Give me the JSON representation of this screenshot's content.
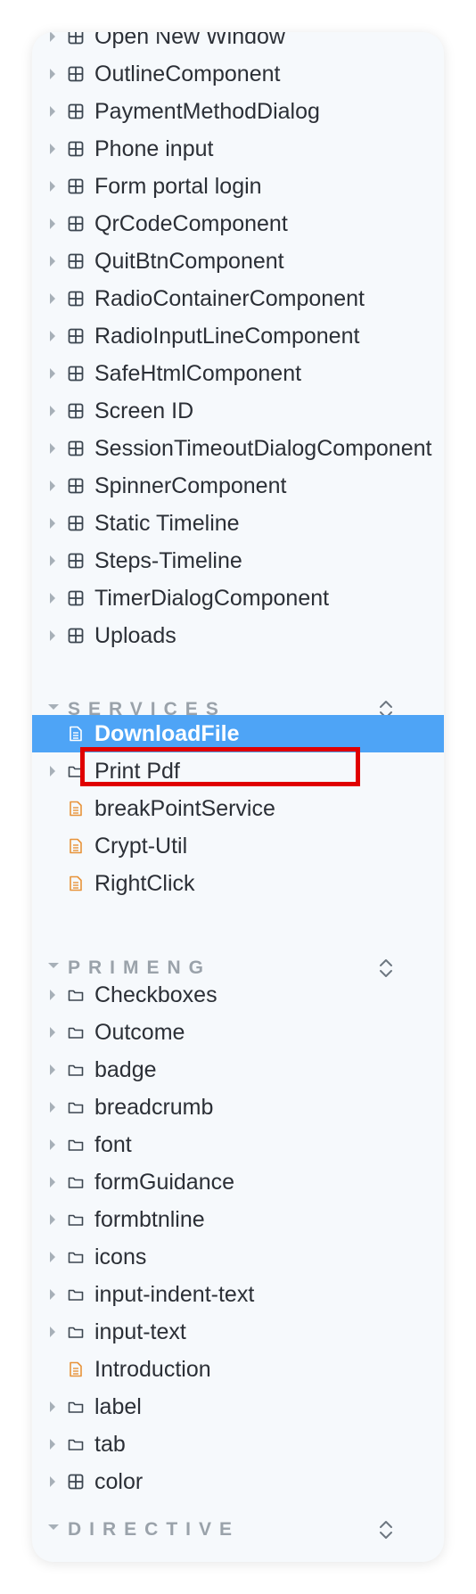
{
  "components": [
    {
      "label": "Open New Window",
      "icon": "component-icon",
      "expandable": true
    },
    {
      "label": "OutlineComponent",
      "icon": "component-icon",
      "expandable": true
    },
    {
      "label": "PaymentMethodDialog",
      "icon": "component-icon",
      "expandable": true
    },
    {
      "label": "Phone input",
      "icon": "component-icon",
      "expandable": true
    },
    {
      "label": "Form portal login",
      "icon": "component-icon",
      "expandable": true
    },
    {
      "label": "QrCodeComponent",
      "icon": "component-icon",
      "expandable": true
    },
    {
      "label": "QuitBtnComponent",
      "icon": "component-icon",
      "expandable": true
    },
    {
      "label": "RadioContainerComponent",
      "icon": "component-icon",
      "expandable": true
    },
    {
      "label": "RadioInputLineComponent",
      "icon": "component-icon",
      "expandable": true
    },
    {
      "label": "SafeHtmlComponent",
      "icon": "component-icon",
      "expandable": true
    },
    {
      "label": "Screen ID",
      "icon": "component-icon",
      "expandable": true
    },
    {
      "label": "SessionTimeoutDialogComponent",
      "icon": "component-icon",
      "expandable": true
    },
    {
      "label": "SpinnerComponent",
      "icon": "component-icon",
      "expandable": true
    },
    {
      "label": "Static Timeline",
      "icon": "component-icon",
      "expandable": true
    },
    {
      "label": "Steps-Timeline",
      "icon": "component-icon",
      "expandable": true
    },
    {
      "label": "TimerDialogComponent",
      "icon": "component-icon",
      "expandable": true
    },
    {
      "label": "Uploads",
      "icon": "component-icon",
      "expandable": true
    }
  ],
  "services": {
    "title": "SERVICES",
    "items": [
      {
        "label": "DownloadFile",
        "icon": "document-icon",
        "expandable": false,
        "selected": true
      },
      {
        "label": "Print Pdf",
        "icon": "folder-icon",
        "expandable": true
      },
      {
        "label": "breakPointService",
        "icon": "document-icon",
        "expandable": false
      },
      {
        "label": "Crypt-Util",
        "icon": "document-icon",
        "expandable": false
      },
      {
        "label": "RightClick",
        "icon": "document-icon",
        "expandable": false
      }
    ]
  },
  "primeng": {
    "title": "PRIMENG",
    "items": [
      {
        "label": "Checkboxes",
        "icon": "folder-icon",
        "expandable": true
      },
      {
        "label": "Outcome",
        "icon": "folder-icon",
        "expandable": true
      },
      {
        "label": "badge",
        "icon": "folder-icon",
        "expandable": true
      },
      {
        "label": "breadcrumb",
        "icon": "folder-icon",
        "expandable": true
      },
      {
        "label": "font",
        "icon": "folder-icon",
        "expandable": true
      },
      {
        "label": "formGuidance",
        "icon": "folder-icon",
        "expandable": true
      },
      {
        "label": "formbtnline",
        "icon": "folder-icon",
        "expandable": true
      },
      {
        "label": "icons",
        "icon": "folder-icon",
        "expandable": true
      },
      {
        "label": "input-indent-text",
        "icon": "folder-icon",
        "expandable": true
      },
      {
        "label": "input-text",
        "icon": "folder-icon",
        "expandable": true
      },
      {
        "label": "Introduction",
        "icon": "document-icon",
        "expandable": false
      },
      {
        "label": "label",
        "icon": "folder-icon",
        "expandable": true
      },
      {
        "label": "tab",
        "icon": "folder-icon",
        "expandable": true
      },
      {
        "label": "color",
        "icon": "component-icon",
        "expandable": true
      }
    ]
  },
  "directive": {
    "title": "DIRECTIVE"
  },
  "colors": {
    "selected_background": "#4ea4f6",
    "document_icon": "#e8933a",
    "highlight_border": "#e00000"
  }
}
